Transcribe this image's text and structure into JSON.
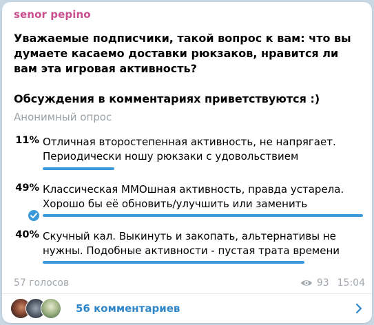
{
  "post": {
    "author": "senor pepino",
    "question": "Уважаемые подписчики, такой вопрос к вам: что вы думаете касаемо доставки рюкзаков, нравится ли вам эта игровая активность?\n\nОбсуждения в комментариях приветствуются :)"
  },
  "poll": {
    "type_label": "Анонимный опрос",
    "options": [
      {
        "percent": "11%",
        "text": "Отличная второстепенная активность, не напрягает. Периодически ношу рюкзаки с удовольствием",
        "share": 0.11,
        "selected": false
      },
      {
        "percent": "49%",
        "text": "Классическая ММОшная активность, правда устарела. Хорошо бы её обновить/улучшить или заменить",
        "share": 0.49,
        "selected": true
      },
      {
        "percent": "40%",
        "text": "Скучный кал. Выкинуть и закопать, альтернативы не нужны. Подобные активности - пустая трата времени",
        "share": 0.4,
        "selected": false
      }
    ],
    "votes_label": "57 голосов",
    "views": "93",
    "time": "15:04"
  },
  "comments": {
    "label": "56 комментариев"
  },
  "colors": {
    "accent": "#3a9ad9",
    "author": "#c94f8f",
    "link": "#2f86c9",
    "muted": "#a2a8ae"
  },
  "icons": [
    "check-icon",
    "eye-icon",
    "chevron-right-icon"
  ]
}
